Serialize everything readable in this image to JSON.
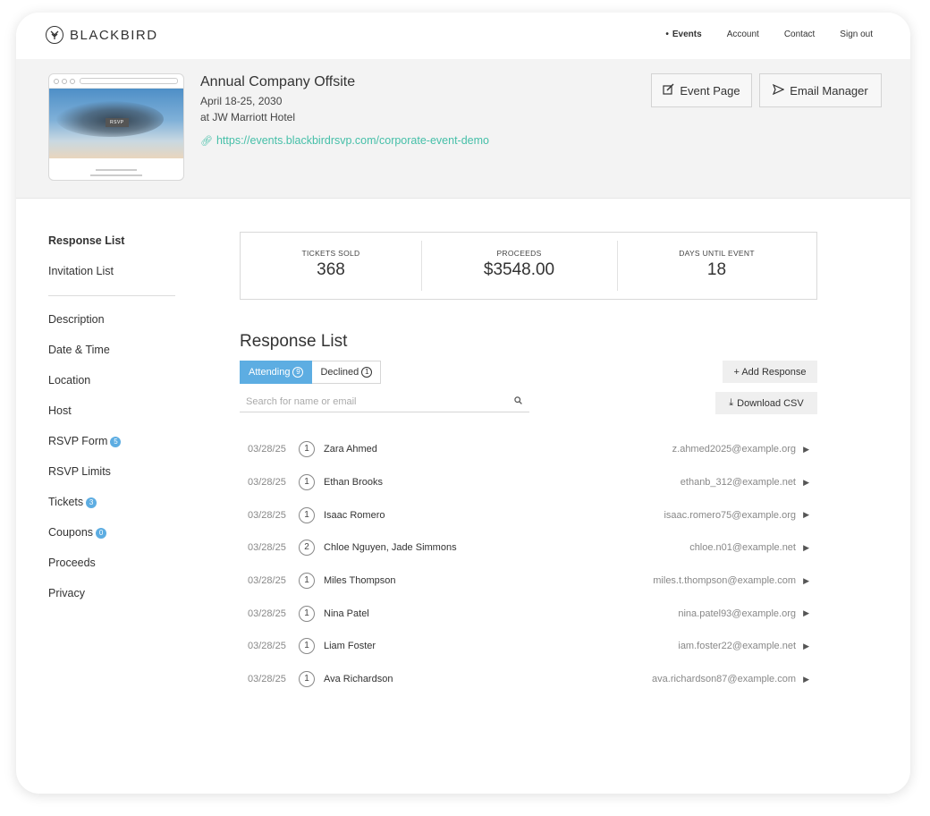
{
  "nav": {
    "brand": "BLACKBIRD",
    "links": [
      "Events",
      "Account",
      "Contact",
      "Sign out"
    ]
  },
  "event": {
    "title": "Annual Company Offsite",
    "dates": "April 18-25, 2030",
    "venue": "at JW Marriott Hotel",
    "url": "https://events.blackbirdrsvp.com/corporate-event-demo",
    "thumb_rsvp": "RSVP"
  },
  "header_buttons": {
    "event_page": "Event Page",
    "email_manager": "Email Manager"
  },
  "sidebar": {
    "items": [
      {
        "label": "Response List"
      },
      {
        "label": "Invitation List"
      },
      {
        "label": "Description"
      },
      {
        "label": "Date & Time"
      },
      {
        "label": "Location"
      },
      {
        "label": "Host"
      },
      {
        "label": "RSVP Form",
        "badge": "5"
      },
      {
        "label": "RSVP Limits"
      },
      {
        "label": "Tickets",
        "badge": "3"
      },
      {
        "label": "Coupons",
        "badge": "0"
      },
      {
        "label": "Proceeds"
      },
      {
        "label": "Privacy"
      }
    ]
  },
  "stats": [
    {
      "label": "TICKETS SOLD",
      "value": "368"
    },
    {
      "label": "PROCEEDS",
      "value": "$3548.00"
    },
    {
      "label": "DAYS UNTIL EVENT",
      "value": "18"
    }
  ],
  "response_list": {
    "title": "Response List",
    "tabs": {
      "attending": "Attending",
      "attending_count": "9",
      "declined": "Declined",
      "declined_count": "1"
    },
    "search_placeholder": "Search for name or email",
    "add_response": "+ Add Response",
    "download_csv": "Download CSV",
    "rows": [
      {
        "date": "03/28/25",
        "count": "1",
        "name": "Zara Ahmed",
        "email": "z.ahmed2025@example.org"
      },
      {
        "date": "03/28/25",
        "count": "1",
        "name": "Ethan Brooks",
        "email": "ethanb_312@example.net"
      },
      {
        "date": "03/28/25",
        "count": "1",
        "name": "Isaac Romero",
        "email": "isaac.romero75@example.org"
      },
      {
        "date": "03/28/25",
        "count": "2",
        "name": "Chloe Nguyen, Jade Simmons",
        "email": "chloe.n01@example.net"
      },
      {
        "date": "03/28/25",
        "count": "1",
        "name": "Miles Thompson",
        "email": "miles.t.thompson@example.com"
      },
      {
        "date": "03/28/25",
        "count": "1",
        "name": "Nina Patel",
        "email": "nina.patel93@example.org"
      },
      {
        "date": "03/28/25",
        "count": "1",
        "name": "Liam Foster",
        "email": "iam.foster22@example.net"
      },
      {
        "date": "03/28/25",
        "count": "1",
        "name": "Ava Richardson",
        "email": "ava.richardson87@example.com"
      }
    ]
  },
  "colors": {
    "accent": "#5dade2",
    "link": "#45bfa8",
    "header_band": "#f3f3f3"
  }
}
